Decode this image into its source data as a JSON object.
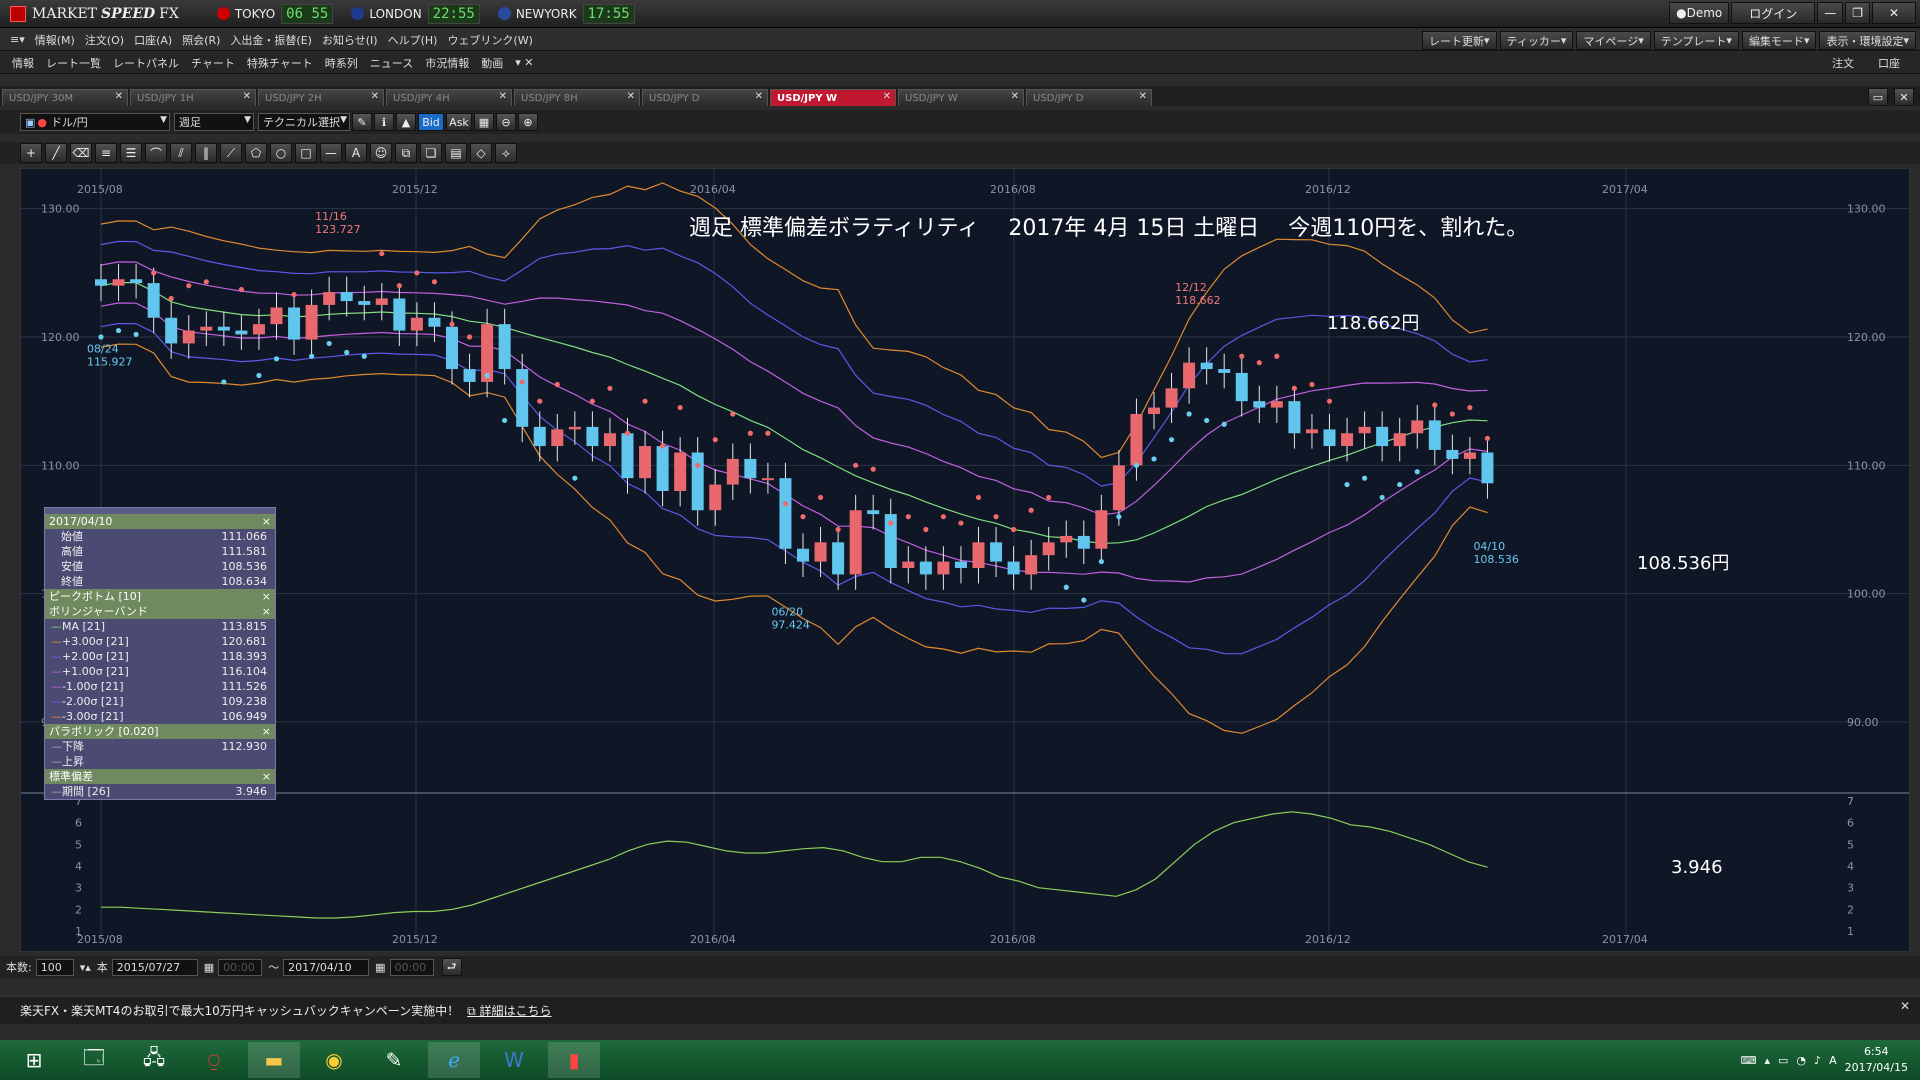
{
  "app": {
    "title": "MARKETSPEED FX",
    "brand_prefix": "MARKET",
    "brand_main": "SPEED",
    "brand_suffix": "FX"
  },
  "clocks": [
    {
      "city": "TOKYO",
      "time": "06 55",
      "flag_color": "#cc0000"
    },
    {
      "city": "LONDON",
      "time": "22:55",
      "flag_color": "#1f3a8a"
    },
    {
      "city": "NEWYORK",
      "time": "17:55",
      "flag_color": "#2a4aa0"
    }
  ],
  "window_buttons": {
    "demo": "Demo",
    "login": "ログイン"
  },
  "menu": [
    "情報(M)",
    "注文(O)",
    "口座(A)",
    "照会(R)",
    "入出金・振替(E)",
    "お知らせ(I)",
    "ヘルプ(H)",
    "ウェブリンク(W)"
  ],
  "right_tools": [
    "レート更新",
    "ティッカー",
    "マイページ",
    "テンプレート",
    "編集モード",
    "表示・環境設定"
  ],
  "toolbar2": [
    "情報",
    "レート一覧",
    "レートパネル",
    "チャート",
    "特殊チャート",
    "時系列",
    "ニュース",
    "市況情報",
    "動画"
  ],
  "toolbar2_right": [
    "注文",
    "口座"
  ],
  "tabs": [
    {
      "label": "USD/JPY 30M",
      "active": false
    },
    {
      "label": "USD/JPY 1H",
      "active": false
    },
    {
      "label": "USD/JPY 2H",
      "active": false
    },
    {
      "label": "USD/JPY 4H",
      "active": false
    },
    {
      "label": "USD/JPY 8H",
      "active": false
    },
    {
      "label": "USD/JPY D",
      "active": false
    },
    {
      "label": "USD/JPY W",
      "active": true
    },
    {
      "label": "USD/JPY W",
      "active": false
    },
    {
      "label": "USD/JPY D",
      "active": false
    }
  ],
  "chart_toolbar": {
    "pair": "ドル/円",
    "period": "週足",
    "tech": "テクニカル選択",
    "bid": "Bid",
    "ask": "Ask"
  },
  "chart_data": {
    "type": "candlestick",
    "title": "週足 標準偏差ボラティリティ　 2017年 4月 15日 土曜日　 今週110円を、割れた。",
    "x_labels": [
      "2015/08",
      "2015/12",
      "2016/04",
      "2016/08",
      "2016/12",
      "2017/04"
    ],
    "y_ticks": [
      90,
      100,
      110,
      120,
      130
    ],
    "y_tick_labels": [
      "90.00",
      "100.00",
      "110.00",
      "120.00",
      "130.00"
    ],
    "ylim": [
      84,
      132
    ],
    "annotations": [
      {
        "date": "08/24",
        "value": "115.927"
      },
      {
        "date": "11/16",
        "value": "123.727"
      },
      {
        "date": "06/20",
        "value": "97.424"
      },
      {
        "date": "12/12",
        "value": "118.662"
      },
      {
        "date": "04/10",
        "value": "108.536"
      }
    ],
    "big_labels": {
      "high": "118.662円",
      "low": "108.536円",
      "stdev": "3.946"
    },
    "closes": [
      124,
      124.5,
      124.2,
      121.5,
      119.5,
      120.5,
      120.8,
      120.5,
      120.2,
      121,
      122.3,
      119.8,
      122.5,
      123.5,
      122.8,
      122.5,
      123,
      120.5,
      121.5,
      120.8,
      117.5,
      116.5,
      121,
      117.5,
      113,
      111.5,
      112.8,
      113,
      111.5,
      112.5,
      109,
      111.5,
      108,
      111,
      106.5,
      108.5,
      110.5,
      109,
      109,
      103.5,
      102.5,
      104,
      101.5,
      106.5,
      106.2,
      102,
      102.5,
      101.5,
      102.5,
      102,
      104,
      102.5,
      101.5,
      103,
      104,
      104.5,
      103.5,
      106.5,
      110,
      114,
      114.5,
      116,
      118,
      117.5,
      117.2,
      115,
      114.5,
      115,
      112.5,
      112.8,
      111.5,
      112.5,
      113,
      111.5,
      112.5,
      113.5,
      111.2,
      110.5,
      111,
      108.6
    ],
    "indicator": {
      "name": "標準偏差",
      "period_label": "期間 [26]",
      "value": 3.946,
      "y_ticks": [
        1,
        2,
        3,
        4,
        5,
        6,
        7
      ],
      "series": [
        2.1,
        2.1,
        2.05,
        2,
        1.95,
        1.9,
        1.85,
        1.8,
        1.75,
        1.7,
        1.65,
        1.6,
        1.6,
        1.65,
        1.75,
        1.85,
        1.9,
        1.9,
        2,
        2.2,
        2.5,
        2.8,
        3.1,
        3.4,
        3.7,
        4,
        4.3,
        4.7,
        5,
        5.15,
        5.1,
        4.9,
        4.7,
        4.6,
        4.6,
        4.7,
        4.8,
        4.85,
        4.7,
        4.4,
        4.2,
        4.2,
        4.4,
        4.4,
        4.2,
        3.9,
        3.5,
        3.3,
        3.0,
        2.9,
        2.8,
        2.7,
        2.6,
        2.9,
        3.4,
        4.2,
        5.0,
        5.6,
        6.0,
        6.2,
        6.4,
        6.5,
        6.4,
        6.2,
        5.9,
        5.8,
        5.6,
        5.3,
        5.0,
        4.6,
        4.2,
        3.946
      ]
    }
  },
  "panel": {
    "date": "2017/04/10",
    "ohlc": [
      {
        "k": "始値",
        "v": "111.066"
      },
      {
        "k": "高値",
        "v": "111.581"
      },
      {
        "k": "安値",
        "v": "108.536"
      },
      {
        "k": "終値",
        "v": "108.634"
      }
    ],
    "peak_header": "ピークボトム [10]",
    "bb_header": "ボリンジャーバンド",
    "bb": [
      {
        "k": "MA [21]",
        "v": "113.815",
        "c": "#7fdc7f"
      },
      {
        "k": "+3.00σ [21]",
        "v": "120.681",
        "c": "#e89030"
      },
      {
        "k": "+2.00σ [21]",
        "v": "118.393",
        "c": "#6a6af0"
      },
      {
        "k": "+1.00σ [21]",
        "v": "116.104",
        "c": "#c060e0"
      },
      {
        "k": "-1.00σ [21]",
        "v": "111.526",
        "c": "#c060e0"
      },
      {
        "k": "-2.00σ [21]",
        "v": "109.238",
        "c": "#6a6af0"
      },
      {
        "k": "-3.00σ [21]",
        "v": "106.949",
        "c": "#e89030"
      }
    ],
    "psar_header": "パラボリック [0.020]",
    "psar": [
      {
        "k": "下降",
        "v": "112.930"
      },
      {
        "k": "上昇",
        "v": ""
      }
    ],
    "sd_header": "標準偏差",
    "sd": [
      {
        "k": "期間 [26]",
        "v": "3.946"
      }
    ]
  },
  "range_bar": {
    "count_label": "本数:",
    "count": "100",
    "unit": "本",
    "from": "2015/07/27",
    "from_time": "00:00",
    "sep": "〜",
    "to": "2017/04/10",
    "to_time": "00:00"
  },
  "ad": {
    "text": "楽天FX・楽天MT4のお取引で最大10万円キャッシュバックキャンペーン実施中！",
    "link": "詳細はこちら"
  },
  "taskbar": {
    "time": "6:54",
    "date": "2017/04/15",
    "ime": "A"
  }
}
